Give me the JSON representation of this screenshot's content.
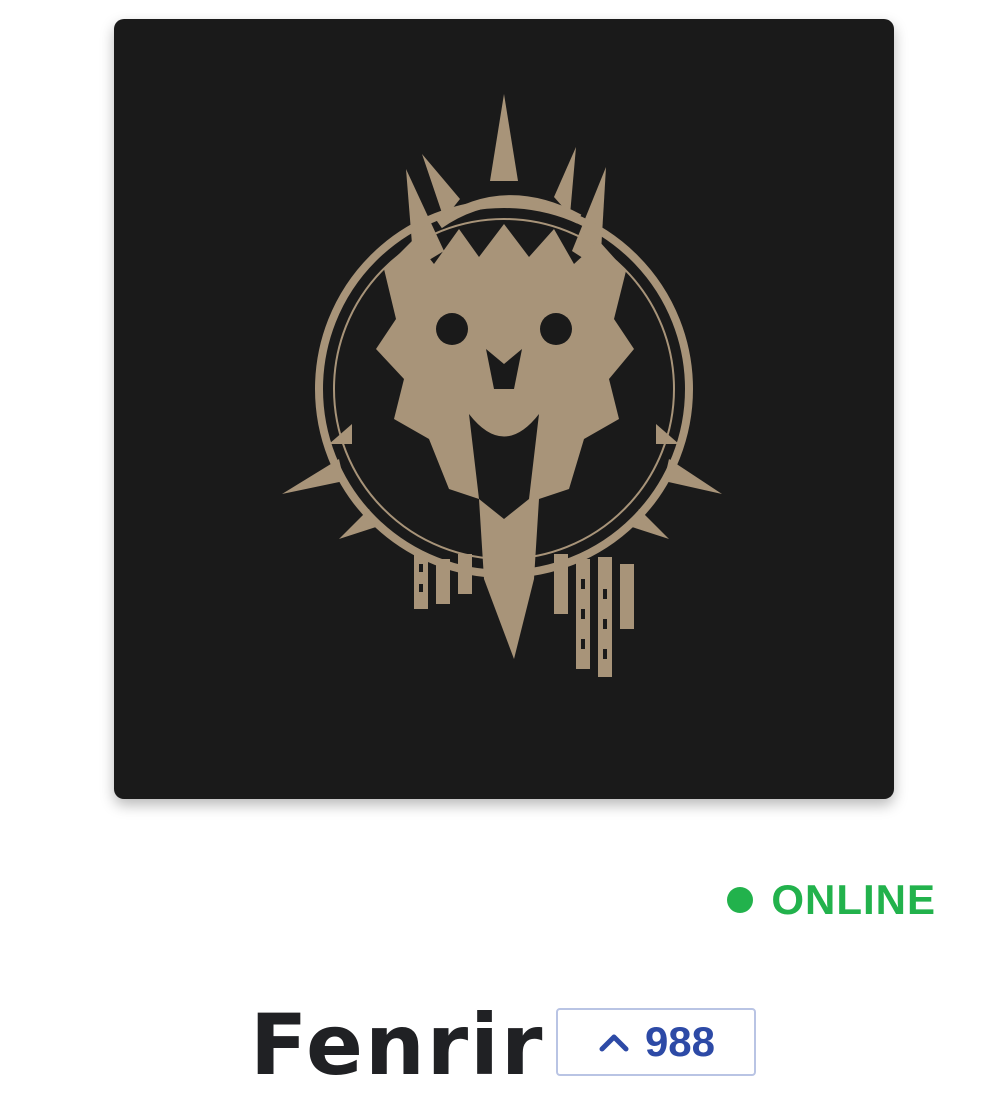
{
  "avatar": {
    "image": "fenrir-wolf-emblem",
    "colors": {
      "background": "#1a1a1a",
      "emblem": "#a89479"
    }
  },
  "status": {
    "label": "ONLINE",
    "color": "#22b24c"
  },
  "profile": {
    "username": "Fenrir"
  },
  "upvote": {
    "icon": "chevron-up-icon",
    "count": "988",
    "color": "#2d4aa6"
  }
}
